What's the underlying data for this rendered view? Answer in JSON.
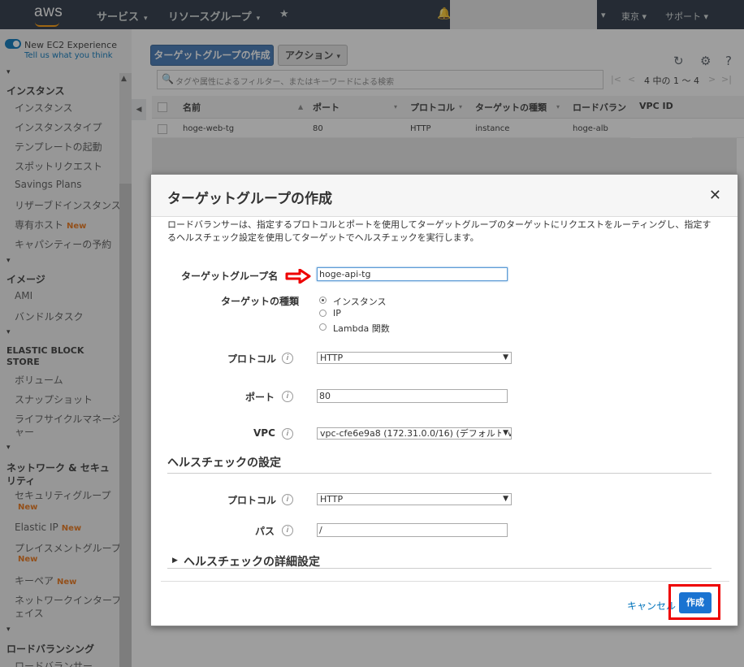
{
  "topnav": {
    "logo": "aws",
    "services": "サービス",
    "resource_groups": "リソースグループ",
    "region": "東京",
    "support": "サポート"
  },
  "sidebar": {
    "experience_title": "New EC2 Experience",
    "experience_link": "Tell us what you think",
    "new_tag": "New",
    "sections": {
      "instances": "インスタンス",
      "images": "イメージ",
      "ebs_line1": "ELASTIC BLOCK",
      "ebs_line2": "STORE",
      "network_line1": "ネットワーク & セキュ",
      "network_line2": "リティ",
      "load_balancing": "ロードバランシング"
    },
    "items": {
      "instances": "インスタンス",
      "instance_types": "インスタンスタイプ",
      "launch_templates": "テンプレートの起動",
      "spot_requests": "スポットリクエスト",
      "savings_plans": "Savings Plans",
      "reserved_instances": "リザーブドインスタンス",
      "dedicated_hosts": "専有ホスト",
      "capacity_reservations": "キャパシティーの予約",
      "ami": "AMI",
      "bundle_tasks": "バンドルタスク",
      "volumes": "ボリューム",
      "snapshots": "スナップショット",
      "lifecycle_1": "ライフサイクルマネージ",
      "lifecycle_2": "ャー",
      "security_groups": "セキュリティグループ",
      "elastic_ip": "Elastic IP",
      "placement_groups": "プレイスメントグループ",
      "key_pairs": "キーペア",
      "network_interfaces_1": "ネットワークインターフ",
      "network_interfaces_2": "ェイス",
      "load_balancers": "ロードバランサー"
    }
  },
  "toolbar": {
    "create_button": "ターゲットグループの作成",
    "action_button": "アクション",
    "search_placeholder": "タグや属性によるフィルター、またはキーワードによる検索",
    "pager": "4 中の 1 ～ 4"
  },
  "table": {
    "columns": [
      "名前",
      "ポート",
      "プロトコル",
      "ターゲットの種類",
      "ロードバラン",
      "VPC ID"
    ],
    "rows": [
      [
        "hoge-web-tg",
        "80",
        "HTTP",
        "instance",
        "hoge-alb",
        ""
      ]
    ]
  },
  "modal": {
    "title": "ターゲットグループの作成",
    "description": "ロードバランサーは、指定するプロトコルとポートを使用してターゲットグループのターゲットにリクエストをルーティングし、指定するヘルスチェック設定を使用してターゲットでヘルスチェックを実行します。",
    "target_group_name_label": "ターゲットグループ名",
    "target_group_name_value": "hoge-api-tg",
    "target_type_label": "ターゲットの種類",
    "target_type_options": [
      "インスタンス",
      "IP",
      "Lambda 関数"
    ],
    "target_type_selected": "インスタンス",
    "protocol_label": "プロトコル",
    "protocol_value": "HTTP",
    "port_label": "ポート",
    "port_value": "80",
    "vpc_label": "VPC",
    "vpc_value": "vpc-cfe6e9a8 (172.31.0.0/16) (デフォルト V",
    "health_title": "ヘルスチェックの設定",
    "health_protocol_label": "プロトコル",
    "health_protocol_value": "HTTP",
    "path_label": "パス",
    "path_value": "/",
    "advanced_title": "ヘルスチェックの詳細設定",
    "cancel": "キャンセル",
    "create": "作成"
  }
}
